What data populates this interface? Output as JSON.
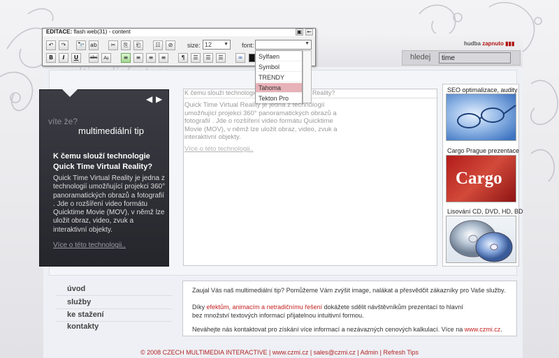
{
  "toolbar": {
    "title_bold": "EDITACE:",
    "title_rest": " flash web(31) - content",
    "size_label": "size:",
    "size_value": "12",
    "font_label": "font:",
    "font_value": "",
    "font_options": [
      "Sylfaen",
      "Symbol",
      "TRENDY",
      "Tahoma",
      "Tekton Pro"
    ],
    "font_selected": "Tahoma",
    "buttons_row1": [
      "↶",
      "↷",
      "🔭",
      "ab",
      "✂",
      "⎘",
      "⎗",
      "☷",
      "⊘"
    ],
    "buttons_row2": [
      "B",
      "I",
      "U",
      "abc",
      "Aᵦ",
      "≡",
      "≡",
      "≡",
      "≡",
      "¶",
      "☰",
      "☰",
      "☰",
      "∞"
    ]
  },
  "header": {
    "audio_label": "hudba",
    "audio_state": "zapnuto",
    "search_label": "hledej",
    "search_value": "time"
  },
  "logo": "multimediafactory",
  "tip": {
    "question": "víte že?",
    "title": "multimediální tip",
    "heading": "K čemu slouží technologie Quick Time Virtual Reality?",
    "body": "Quick Time Virtual Reality je jedna z technologií umožňující projekci 360° panoramatických obrazů a fotografií . Jde o rozšíření video formátu Quicktime Movie (MOV), v němž lze uložit obraz, video, zvuk a interaktivní objekty.",
    "link": "Více o této technologii.."
  },
  "editor": {
    "header": "K čemu slouží technologie Quick Time Virtual Reality?",
    "body": "Quick Time Virtual Reality je jedna z technologií umožňující projekci 360° panoramatických obrazů a fotografií . Jde o rozšíření video formátu Quicktime Movie (MOV), v němž lze uložit obraz, video, zvuk a interaktivní objekty.",
    "link": "Více o této technologii.."
  },
  "side": {
    "items": [
      {
        "title": "SEO optimalizace, audity"
      },
      {
        "title": "Cargo Prague prezentace",
        "image_text": "Cargo"
      },
      {
        "title": "Lisování CD, DVD, HD, BD"
      }
    ]
  },
  "nav": {
    "items": [
      "úvod",
      "služby",
      "ke stažení",
      "kontakty"
    ]
  },
  "info": {
    "line1": "Zaujal Vás naš multimediální tip? Pomůžeme Vám zvýšit image, nalákat a přesvědčit zákazníky pro Vaše služby.",
    "line2_a": "Díky ",
    "line2_red1": "efektům",
    "line2_b": ", ",
    "line2_red2": "animacím a netradičnímu řešení",
    "line2_c": " dokážete sdělit návštěvníkům prezentací to hlavní",
    "line3": "bez množství textových informací přijatelnou intuitivní formou.",
    "line4_a": "Neváhejte nás kontaktovat pro získání více informací a nezávazných cenových kalkulací. Více na ",
    "line4_link": "www.czmi.cz",
    "line4_b": "."
  },
  "footer": "© 2008 CZECH MULTIMEDIA INTERACTIVE | www.czmi.cz | sales@czmi.cz | Admin | Refresh Tips",
  "colors": {
    "accent": "#c42020",
    "tip_bg": "#2e2e35"
  }
}
